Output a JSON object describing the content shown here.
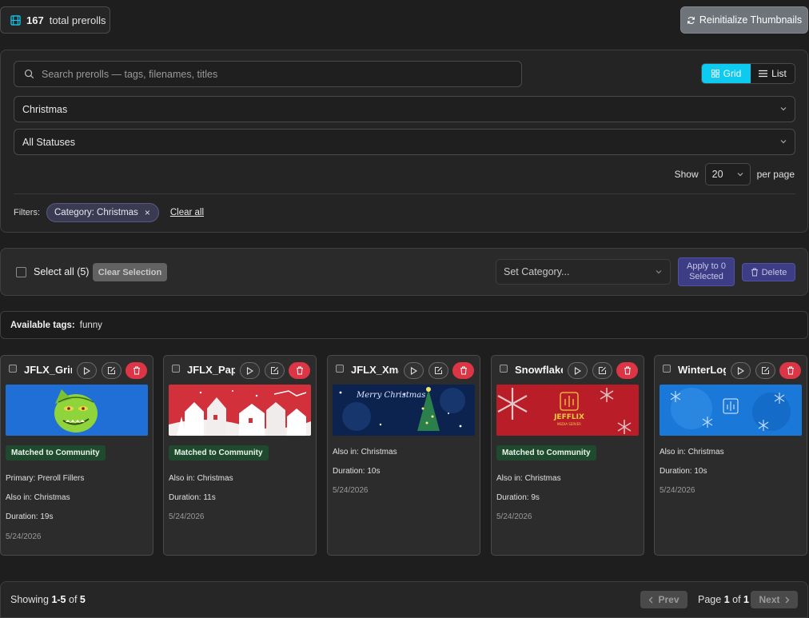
{
  "header": {
    "total_count": "167",
    "total_label": "total prerolls",
    "reinit_label": "Reinitialize Thumbnails"
  },
  "filters": {
    "search_placeholder": "Search prerolls — tags, filenames, titles",
    "view_grid_label": "Grid",
    "view_list_label": "List",
    "view_active": "grid",
    "category_value": "Christmas",
    "status_value": "All Statuses",
    "show_label": "Show",
    "per_page_value": "20",
    "per_page_suffix": "per page",
    "filters_label": "Filters:",
    "active_chip": "Category: Christmas",
    "chip_remove_glyph": "×",
    "clear_all_label": "Clear all"
  },
  "bulk": {
    "select_all_label": "Select all (5)",
    "clear_selection_label": "Clear Selection",
    "set_category_placeholder": "Set Category...",
    "apply_line1": "Apply to 0",
    "apply_line2": "Selected",
    "delete_label": "Delete"
  },
  "tags": {
    "label": "Available tags:",
    "value": "funny"
  },
  "cards": [
    {
      "title": "JFLX_Grinch",
      "thumb": "grinch",
      "badge": "Matched to Community",
      "lines": [
        "Primary: Preroll Fillers",
        "Also in: Christmas",
        "Duration: 19s"
      ],
      "date": "5/24/2026"
    },
    {
      "title": "JFLX_Paper",
      "thumb": "paper-village",
      "badge": "Matched to Community",
      "lines": [
        "Also in: Christmas",
        "Duration: 11s"
      ],
      "date": "5/24/2026"
    },
    {
      "title": "JFLX_Xmas",
      "thumb": "merry-christmas-tree",
      "thumb_text": "Merry Christmas",
      "badge": "",
      "lines": [
        "Also in: Christmas",
        "Duration: 10s"
      ],
      "date": "5/24/2026"
    },
    {
      "title": "Snowflake",
      "thumb": "red-snowflake-logo",
      "thumb_text": "JEFFLIX",
      "thumb_subtext": "MEDIA SERVER",
      "badge": "Matched to Community",
      "lines": [
        "Also in: Christmas",
        "Duration: 9s"
      ],
      "date": "5/24/2026"
    },
    {
      "title": "WinterLogo",
      "thumb": "blue-snowflakes",
      "badge": "",
      "lines": [
        "Also in: Christmas",
        "Duration: 10s"
      ],
      "date": "5/24/2026"
    }
  ],
  "pagination": {
    "showing_prefix": "Showing",
    "range": "1-5",
    "of_word": "of",
    "total": "5",
    "prev_label": "Prev",
    "next_label": "Next",
    "page_prefix": "Page",
    "page_current": "1",
    "page_total": "1"
  },
  "colors": {
    "accent_cyan": "#0dcaf0",
    "danger": "#dc3545",
    "badge_green": "#1f4a2e",
    "indigo": "#3d3d85"
  }
}
